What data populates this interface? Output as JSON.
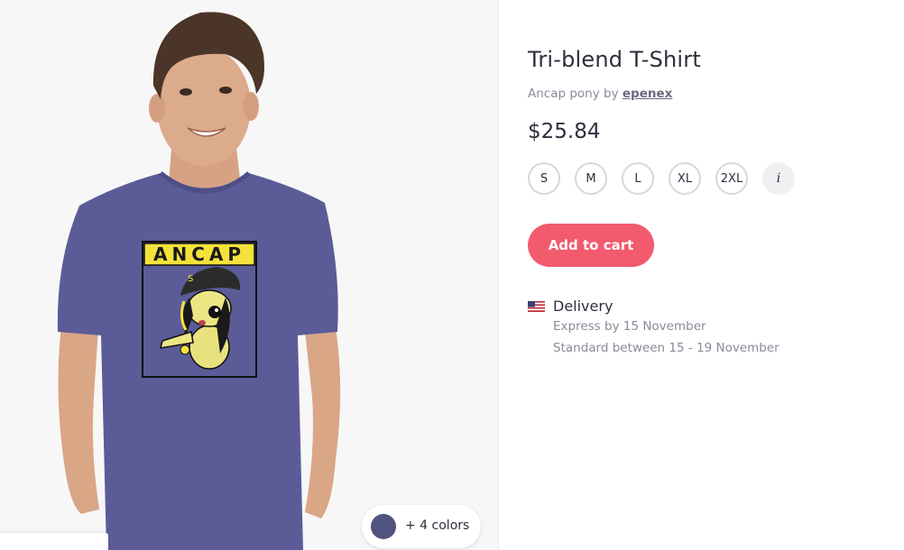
{
  "product": {
    "title": "Tri-blend T-Shirt",
    "design_name": "Ancap pony",
    "by_word": "by",
    "artist": "epenex",
    "price": "$25.84"
  },
  "design": {
    "banner_text": "ANCAP",
    "cap_mark": "S",
    "shirt_color": "#5b5c97",
    "banner_color": "#f4e23a"
  },
  "sizes": [
    "S",
    "M",
    "L",
    "XL",
    "2XL"
  ],
  "size_info_label": "i",
  "colors": {
    "swatch_color": "#505280",
    "more_label": "+ 4 colors"
  },
  "cart": {
    "label": "Add to cart",
    "color": "#f25a6e"
  },
  "delivery": {
    "title": "Delivery",
    "express": "Express by 15 November",
    "standard": "Standard between 15 - 19 November"
  }
}
